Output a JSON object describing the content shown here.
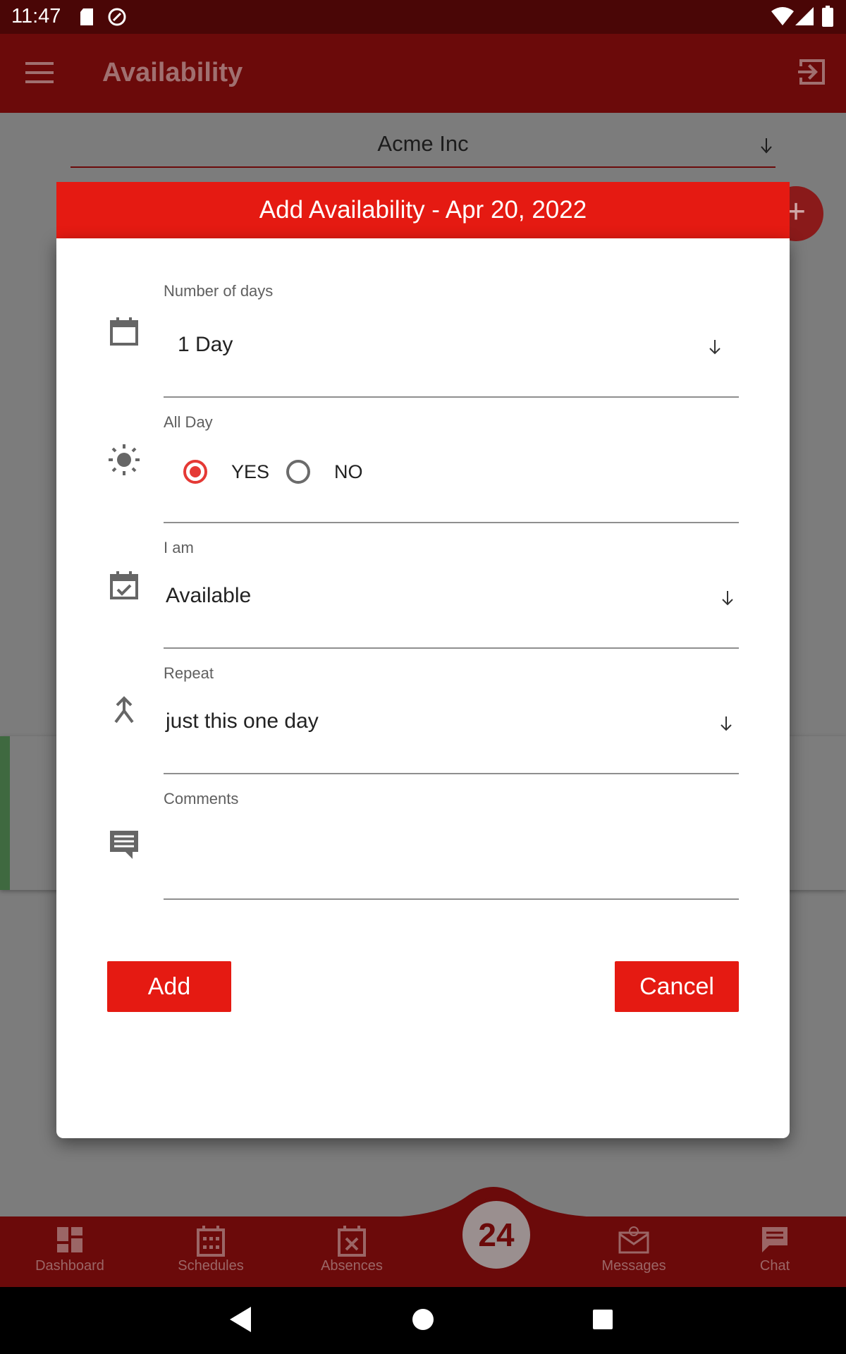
{
  "status_bar": {
    "time": "11:47"
  },
  "app_bar": {
    "title": "Availability"
  },
  "background": {
    "company": "Acme Inc",
    "fab_label": "+"
  },
  "dialog": {
    "title": "Add Availability - Apr 20, 2022",
    "fields": {
      "days_label": "Number of days",
      "days_value": "1 Day",
      "allday_label": "All Day",
      "allday_yes": "YES",
      "allday_no": "NO",
      "iam_label": "I am",
      "iam_value": "Available",
      "repeat_label": "Repeat",
      "repeat_value": "just this one day",
      "comments_label": "Comments",
      "comments_value": ""
    },
    "add_button": "Add",
    "cancel_button": "Cancel"
  },
  "bottom_nav": {
    "items": [
      {
        "label": "Dashboard",
        "icon": "dashboard-icon"
      },
      {
        "label": "Schedules",
        "icon": "calendar-grid-icon"
      },
      {
        "label": "Absences",
        "icon": "calendar-x-icon"
      },
      {
        "label": "Messages",
        "icon": "envelope-at-icon"
      },
      {
        "label": "Chat",
        "icon": "chat-icon"
      }
    ],
    "center_badge": "24"
  },
  "colors": {
    "app_bar": "#6b0a0a",
    "accent": "#e51a12",
    "radio_selected": "#e53935"
  }
}
